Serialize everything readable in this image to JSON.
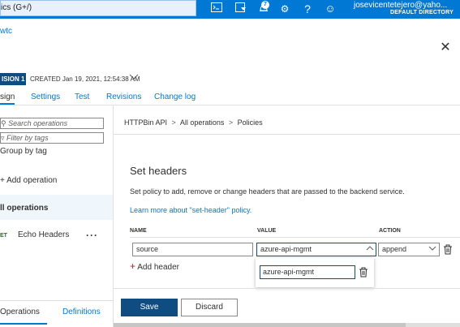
{
  "top_bar": {
    "search_text": "ics (G+/)",
    "notification_count": "7",
    "user_email": "josevicentetejero@yaho...",
    "user_directory": "DEFAULT DIRECTORY"
  },
  "breadcrumb_link": "wtc",
  "revision": {
    "badge": "ISION 1",
    "created": "CREATED Jan 19, 2021, 12:54:38 AM"
  },
  "tabs": [
    "sign",
    "Settings",
    "Test",
    "Revisions",
    "Change log"
  ],
  "left_panel": {
    "search_placeholder": "Search operations",
    "filter_placeholder": "Filter by tags",
    "group_by_tag": "Group by tag",
    "add_operation": "Add operation",
    "all_operations": "ll operations",
    "operation_method": "ET",
    "operation_name": "Echo Headers",
    "bottom_tabs": [
      "Operations",
      "Definitions"
    ]
  },
  "right_panel": {
    "crumb": [
      "HTTPBin API",
      ">",
      "All operations",
      ">",
      "Policies"
    ],
    "title": "Set headers",
    "description": "Set policy to add, remove or change headers that are passed to the backend service.",
    "learn_more": "Learn more about \"set-header\" policy.",
    "columns": [
      "NAME",
      "VALUE",
      "ACTION"
    ],
    "row": {
      "name": "source",
      "value": "azure-api-mgmt",
      "action": "append"
    },
    "add_header": "Add header",
    "dropdown_value": "azure-api-mgmt",
    "save": "Save",
    "discard": "Discard"
  },
  "colors": {
    "topbar": "#0078d4",
    "primary_button": "#0f4c81",
    "link": "#0078d4",
    "selected_row": "#eff6fc",
    "get_method": "#107c10"
  },
  "icons": [
    "cloud-shell-icon",
    "directory-filter-icon",
    "notifications-icon",
    "settings-icon",
    "help-icon",
    "feedback-icon",
    "close-icon",
    "chevron-down-icon",
    "search-icon",
    "filter-icon",
    "plus-icon",
    "more-icon",
    "trash-icon"
  ]
}
